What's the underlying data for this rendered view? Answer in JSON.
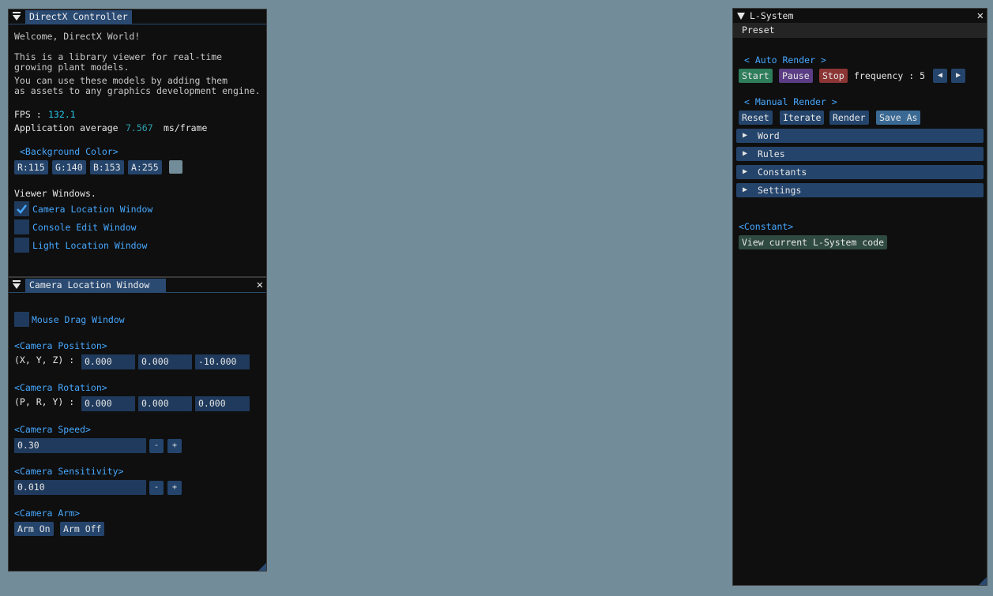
{
  "controller": {
    "title": "DirectX Controller",
    "welcome": "Welcome, DirectX World!",
    "desc1a": "This is a library viewer for real-time",
    "desc1b": "growing plant models.",
    "desc2a": "You can use these models by adding them",
    "desc2b": "as assets to any graphics development engine.",
    "fps_label": "FPS :",
    "fps_value": "132.1",
    "avg_label": "Application average",
    "avg_value": "7.567",
    "avg_unit": "ms/frame",
    "bg_header": "<Background Color>",
    "r": "R:115",
    "g": "G:140",
    "b": "B:153",
    "a": "A:255",
    "swatch_color": "#738c99",
    "viewer_label": "Viewer Windows.",
    "checks": [
      {
        "label": "Camera Location Window",
        "checked": true
      },
      {
        "label": "Console Edit Window",
        "checked": false
      },
      {
        "label": "Light Location Window",
        "checked": false
      }
    ]
  },
  "camera": {
    "title": "Camera Location Window",
    "mouse_drag": "Mouse Drag Window",
    "pos_header": "<Camera Position>",
    "pos_label": "(X, Y, Z) :",
    "pos": [
      "0.000",
      "0.000",
      "-10.000"
    ],
    "rot_header": "<Camera Rotation>",
    "rot_label": "(P, R, Y) :",
    "rot": [
      "0.000",
      "0.000",
      "0.000"
    ],
    "speed_header": "<Camera Speed>",
    "speed_value": "0.30",
    "sens_header": "<Camera Sensitivity>",
    "sens_value": "0.010",
    "minus": "-",
    "plus": "+",
    "arm_header": "<Camera Arm>",
    "arm_on": "Arm On",
    "arm_off": "Arm Off"
  },
  "lsystem": {
    "title": "L-System",
    "menu_preset": "Preset",
    "auto_header": "< Auto Render >",
    "start": "Start",
    "pause": "Pause",
    "stop": "Stop",
    "freq_label": "frequency : 5",
    "manual_header": "< Manual Render >",
    "reset": "Reset",
    "iterate": "Iterate",
    "render": "Render",
    "save_as": "Save As",
    "sections": [
      "Word",
      "Rules",
      "Constants",
      "Settings"
    ],
    "constant_header": "<Constant>",
    "view_code": "View current L-System code",
    "colors": {
      "start": "#2e7d5b",
      "pause": "#5b3d85",
      "stop": "#8c3535",
      "save_as": "#3a6a94",
      "view_code": "#2f4a40"
    }
  }
}
